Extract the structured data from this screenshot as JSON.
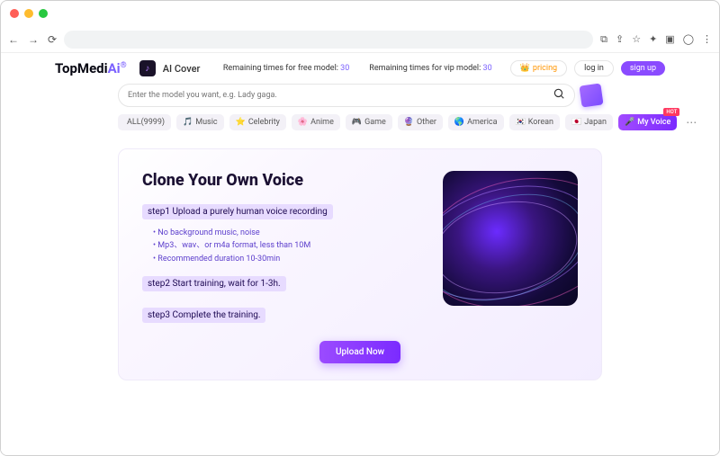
{
  "header": {
    "brand_main": "TopMedi",
    "brand_accent": "Ai",
    "app_name": "AI Cover",
    "free_status_label": "Remaining times for free model:",
    "free_status_value": "30",
    "vip_status_label": "Remaining times for vip model:",
    "vip_status_value": "30",
    "pricing_label": "pricing",
    "login_label": "log in",
    "signup_label": "sign up"
  },
  "search": {
    "placeholder": "Enter the model you want, e.g. Lady gaga."
  },
  "categories": [
    {
      "icon": "",
      "label": "ALL(9999)"
    },
    {
      "icon": "🎵",
      "label": "Music"
    },
    {
      "icon": "⭐",
      "label": "Celebrity"
    },
    {
      "icon": "🌸",
      "label": "Anime"
    },
    {
      "icon": "🎮",
      "label": "Game"
    },
    {
      "icon": "🔮",
      "label": "Other"
    },
    {
      "icon": "🌎",
      "label": "America"
    },
    {
      "icon": "🇰🇷",
      "label": "Korean"
    },
    {
      "icon": "🇯🇵",
      "label": "Japan"
    }
  ],
  "myvoice": {
    "label": "My Voice",
    "badge": "HOT"
  },
  "card": {
    "title": "Clone Your Own Voice",
    "step1": "step1  Upload a purely human voice recording",
    "bullets": [
      "No background music, noise",
      "Mp3、wav、or m4a format, less than 10M",
      "Recommended duration 10-30min"
    ],
    "step2": "step2  Start training, wait for 1-3h.",
    "step3": "step3  Complete the training.",
    "upload_label": "Upload Now"
  }
}
